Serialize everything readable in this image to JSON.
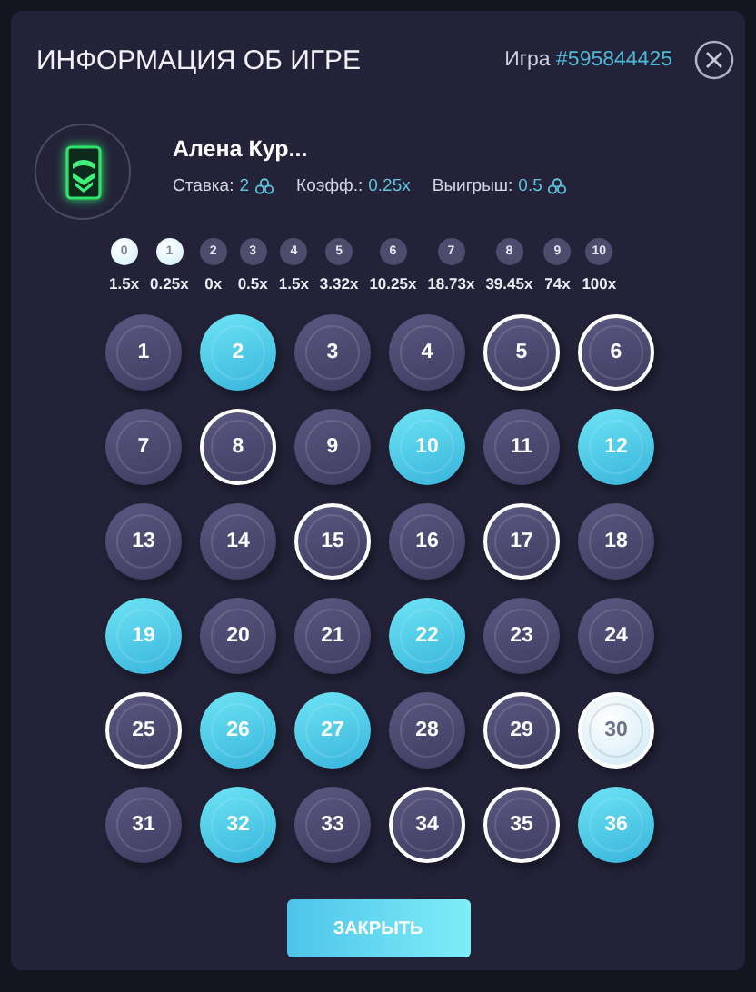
{
  "dialog": {
    "title": "ИНФОРМАЦИЯ ОБ ИГРЕ",
    "game_label": "Игра",
    "game_id": "#595844425"
  },
  "player": {
    "name": "Алена Кур...",
    "stats": [
      {
        "label": "Ставка:",
        "value": "2",
        "currency": true
      },
      {
        "label": "Коэфф.:",
        "value": "0.25x",
        "currency": false
      },
      {
        "label": "Выигрыш:",
        "value": "0.5",
        "currency": true
      }
    ]
  },
  "payouts": [
    {
      "hits": "0",
      "multiplier": "1.5x",
      "reached": true
    },
    {
      "hits": "1",
      "multiplier": "0.25x",
      "reached": true
    },
    {
      "hits": "2",
      "multiplier": "0x",
      "reached": false
    },
    {
      "hits": "3",
      "multiplier": "0.5x",
      "reached": false
    },
    {
      "hits": "4",
      "multiplier": "1.5x",
      "reached": false
    },
    {
      "hits": "5",
      "multiplier": "3.32x",
      "reached": false
    },
    {
      "hits": "6",
      "multiplier": "10.25x",
      "reached": false
    },
    {
      "hits": "7",
      "multiplier": "18.73x",
      "reached": false
    },
    {
      "hits": "8",
      "multiplier": "39.45x",
      "reached": false
    },
    {
      "hits": "9",
      "multiplier": "74x",
      "reached": false
    },
    {
      "hits": "10",
      "multiplier": "100x",
      "reached": false
    }
  ],
  "balls": [
    {
      "number": "1",
      "kind": "plain"
    },
    {
      "number": "2",
      "kind": "drawn"
    },
    {
      "number": "3",
      "kind": "plain"
    },
    {
      "number": "4",
      "kind": "plain"
    },
    {
      "number": "5",
      "kind": "picked"
    },
    {
      "number": "6",
      "kind": "picked"
    },
    {
      "number": "7",
      "kind": "plain"
    },
    {
      "number": "8",
      "kind": "picked"
    },
    {
      "number": "9",
      "kind": "plain"
    },
    {
      "number": "10",
      "kind": "drawn"
    },
    {
      "number": "11",
      "kind": "plain"
    },
    {
      "number": "12",
      "kind": "drawn"
    },
    {
      "number": "13",
      "kind": "plain"
    },
    {
      "number": "14",
      "kind": "plain"
    },
    {
      "number": "15",
      "kind": "picked"
    },
    {
      "number": "16",
      "kind": "plain"
    },
    {
      "number": "17",
      "kind": "picked"
    },
    {
      "number": "18",
      "kind": "plain"
    },
    {
      "number": "19",
      "kind": "drawn"
    },
    {
      "number": "20",
      "kind": "plain"
    },
    {
      "number": "21",
      "kind": "plain"
    },
    {
      "number": "22",
      "kind": "drawn"
    },
    {
      "number": "23",
      "kind": "plain"
    },
    {
      "number": "24",
      "kind": "plain"
    },
    {
      "number": "25",
      "kind": "picked"
    },
    {
      "number": "26",
      "kind": "drawn"
    },
    {
      "number": "27",
      "kind": "drawn"
    },
    {
      "number": "28",
      "kind": "plain"
    },
    {
      "number": "29",
      "kind": "picked"
    },
    {
      "number": "30",
      "kind": "hit"
    },
    {
      "number": "31",
      "kind": "plain"
    },
    {
      "number": "32",
      "kind": "drawn"
    },
    {
      "number": "33",
      "kind": "plain"
    },
    {
      "number": "34",
      "kind": "picked"
    },
    {
      "number": "35",
      "kind": "picked"
    },
    {
      "number": "36",
      "kind": "drawn"
    }
  ],
  "close_button": "ЗАКРЫТЬ"
}
